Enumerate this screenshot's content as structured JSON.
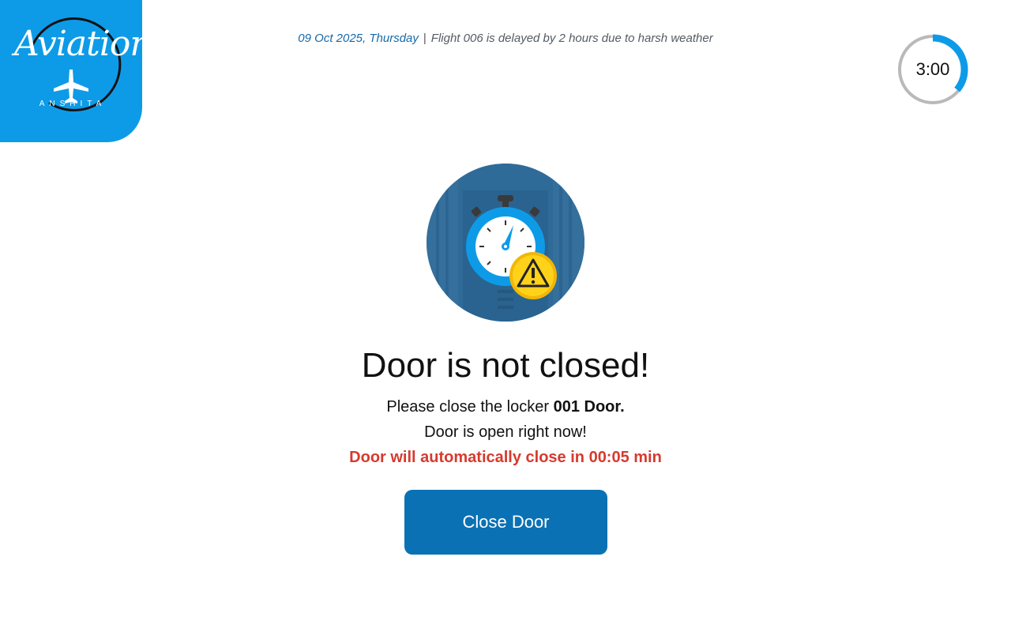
{
  "brand": {
    "logo_script": "Aviation",
    "logo_subtitle": "ANSHITA",
    "logo_color": "#0d9be8"
  },
  "ticker": {
    "date": "09 Oct 2025, Thursday",
    "separator": "|",
    "message": "Flight 006 is delayed by 2 hours due to harsh weather"
  },
  "timer": {
    "label": "3:00",
    "progress_fraction": 0.36,
    "accent_color": "#0d9be8"
  },
  "hero": {
    "icon": "stopwatch-warning-icon"
  },
  "alert": {
    "title": "Door is not closed!",
    "instruction_prefix": "Please close the locker ",
    "locker_id": "001 Door.",
    "status": "Door is open right now!",
    "auto_close": "Door will automatically close in 00:05 min",
    "warning_color": "#d63a2f"
  },
  "actions": {
    "close_door_label": "Close Door",
    "button_color": "#0a72b4"
  }
}
